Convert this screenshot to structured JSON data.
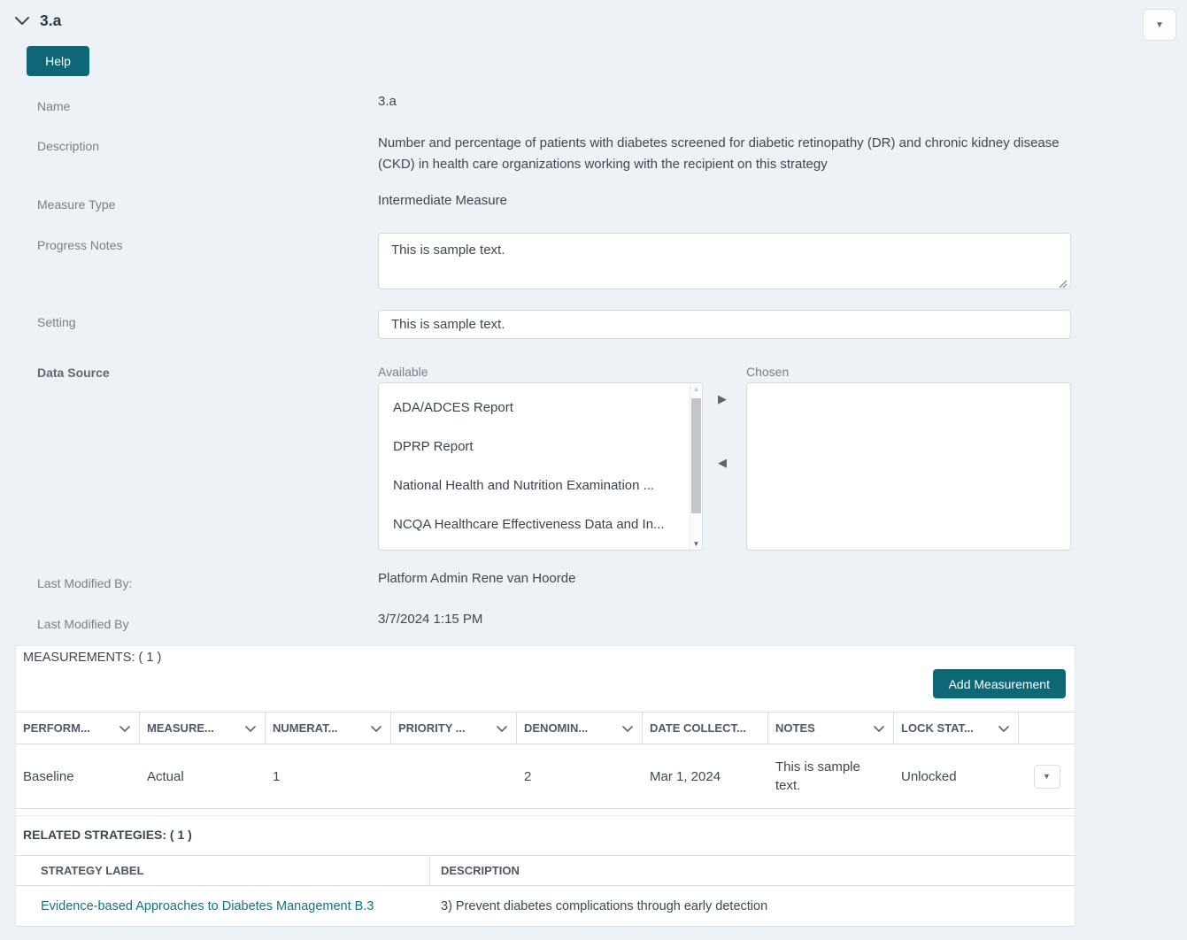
{
  "colors": {
    "accent_teal": "#0d6775",
    "link_teal": "#177185",
    "page_bg": "#edf2f6"
  },
  "header": {
    "title": "3.a"
  },
  "toolbar": {
    "help_label": "Help"
  },
  "form": {
    "name": {
      "label": "Name",
      "value": "3.a"
    },
    "description": {
      "label": "Description",
      "value": "Number and percentage of patients with diabetes screened for diabetic retinopathy (DR) and chronic kidney disease (CKD) in health care organizations working with the recipient on this strategy"
    },
    "measure_type": {
      "label": "Measure Type",
      "value": "Intermediate Measure"
    },
    "progress_notes": {
      "label": "Progress Notes",
      "value": "This is sample text."
    },
    "setting": {
      "label": "Setting",
      "value": "This is sample text."
    },
    "data_source": {
      "label": "Data Source",
      "available_label": "Available",
      "chosen_label": "Chosen",
      "available_items": [
        "ADA/ADCES Report",
        "DPRP Report",
        "National Health and Nutrition Examination ...",
        "NCQA Healthcare Effectiveness Data and In..."
      ],
      "chosen_items": []
    },
    "last_modified_by": {
      "label": "Last Modified By:",
      "value": "Platform Admin Rene van Hoorde"
    },
    "last_modified_date": {
      "label": "Last Modified By",
      "value": "3/7/2024 1:15 PM"
    }
  },
  "measurements": {
    "title": "MEASUREMENTS: ( 1 )",
    "add_button_label": "Add Measurement",
    "columns": [
      {
        "label": "PERFORM..."
      },
      {
        "label": "MEASURE..."
      },
      {
        "label": "NUMERAT..."
      },
      {
        "label": "PRIORITY ..."
      },
      {
        "label": "DENOMIN..."
      },
      {
        "label": "DATE COLLECT..."
      },
      {
        "label": "NOTES"
      },
      {
        "label": "LOCK STAT..."
      }
    ],
    "rows": [
      {
        "cells": [
          "Baseline",
          "Actual",
          "1",
          "",
          "2",
          "Mar 1, 2024",
          "This is sample text.",
          "Unlocked"
        ]
      }
    ]
  },
  "related_strategies": {
    "title": "RELATED STRATEGIES: ( 1 )",
    "columns": [
      {
        "label": "STRATEGY LABEL"
      },
      {
        "label": "DESCRIPTION"
      }
    ],
    "rows": [
      {
        "strategy_label": "Evidence-based Approaches to Diabetes Management B.3",
        "description": "3) Prevent diabetes complications through early detection"
      }
    ]
  }
}
